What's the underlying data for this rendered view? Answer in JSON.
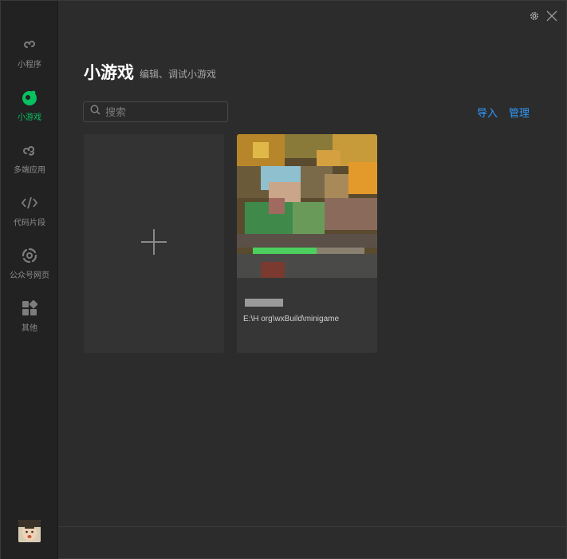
{
  "sidebar": {
    "items": [
      {
        "label": "小程序",
        "icon": "miniprogram-icon"
      },
      {
        "label": "小游戏",
        "icon": "minigame-icon",
        "active": true
      },
      {
        "label": "多端应用",
        "icon": "multiplatform-icon"
      },
      {
        "label": "代码片段",
        "icon": "code-snippet-icon"
      },
      {
        "label": "公众号网页",
        "icon": "official-account-web-icon"
      },
      {
        "label": "其他",
        "icon": "other-apps-icon"
      }
    ],
    "avatar": "user-avatar"
  },
  "header": {
    "title": "小游戏",
    "subtitle": "编辑、调试小游戏"
  },
  "search": {
    "placeholder": "搜索",
    "value": ""
  },
  "actions": {
    "import_label": "导入",
    "manage_label": "管理"
  },
  "projects": [
    {
      "path": "E:\\H        org\\wxBuild\\minigame"
    }
  ],
  "colors": {
    "accent": "#07c160",
    "link": "#2f9bff",
    "background": "#2c2c2c",
    "sidebar": "#222222"
  }
}
